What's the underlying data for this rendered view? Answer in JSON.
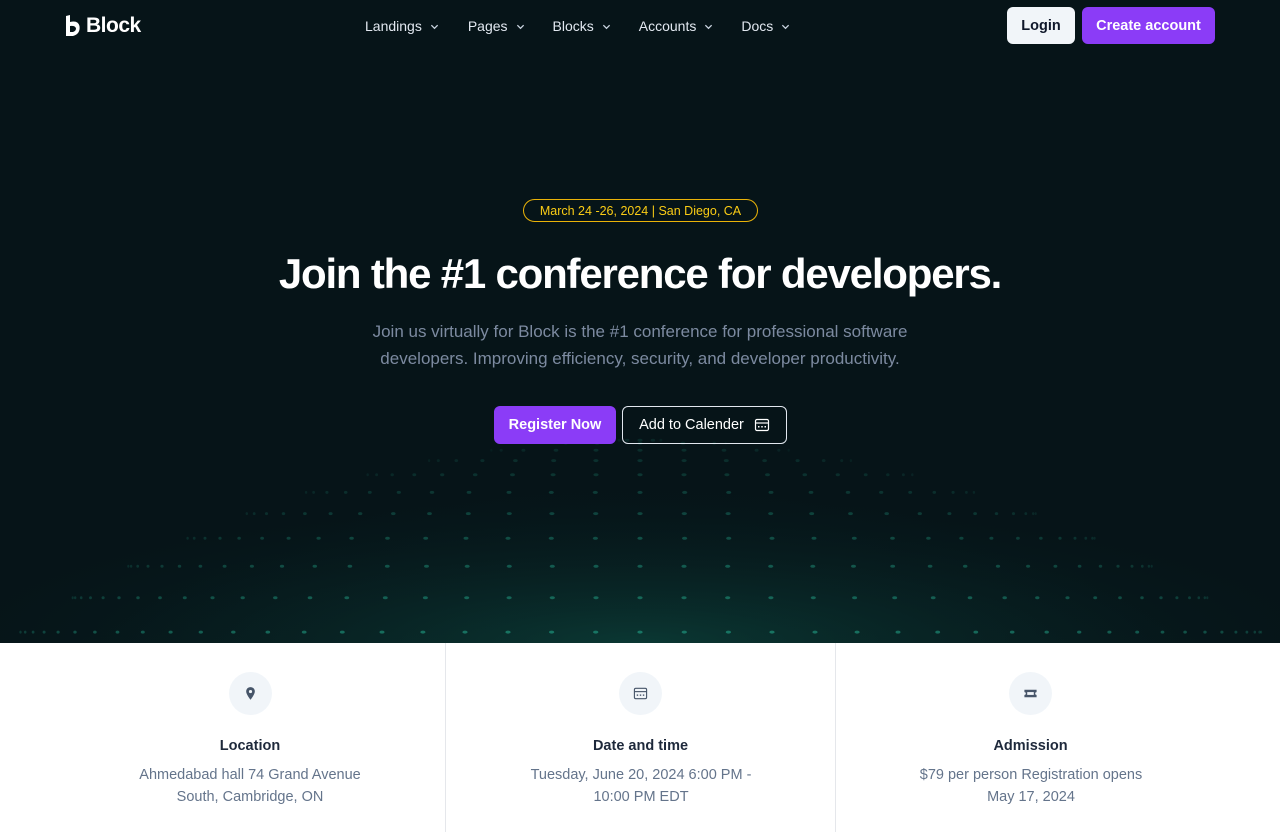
{
  "brand": {
    "name": "Block"
  },
  "nav": {
    "items": [
      {
        "label": "Landings"
      },
      {
        "label": "Pages"
      },
      {
        "label": "Blocks"
      },
      {
        "label": "Accounts"
      },
      {
        "label": "Docs"
      }
    ],
    "login_label": "Login",
    "create_label": "Create account"
  },
  "hero": {
    "badge": "March 24 -26, 2024 | San Diego, CA",
    "headline": "Join the #1 conference for developers.",
    "subtext": "Join us virtually for Block is the #1 conference for professional software developers. Improving efficiency, security, and developer productivity.",
    "register_label": "Register Now",
    "calendar_label": "Add to Calender"
  },
  "info": {
    "location": {
      "title": "Location",
      "text": "Ahmedabad hall 74 Grand Avenue South, Cambridge, ON",
      "icon": "map-pin-icon"
    },
    "datetime": {
      "title": "Date and time",
      "text": "Tuesday, June 20, 2024 6:00 PM - 10:00 PM EDT",
      "icon": "calendar-icon"
    },
    "admission": {
      "title": "Admission",
      "text": "$79 per person Registration opens May 17, 2024",
      "icon": "ticket-icon"
    }
  },
  "colors": {
    "accent": "#8b3cf7",
    "badge": "#eab308",
    "hero_bg": "#061418",
    "globe_dots": "#1f8f78"
  }
}
